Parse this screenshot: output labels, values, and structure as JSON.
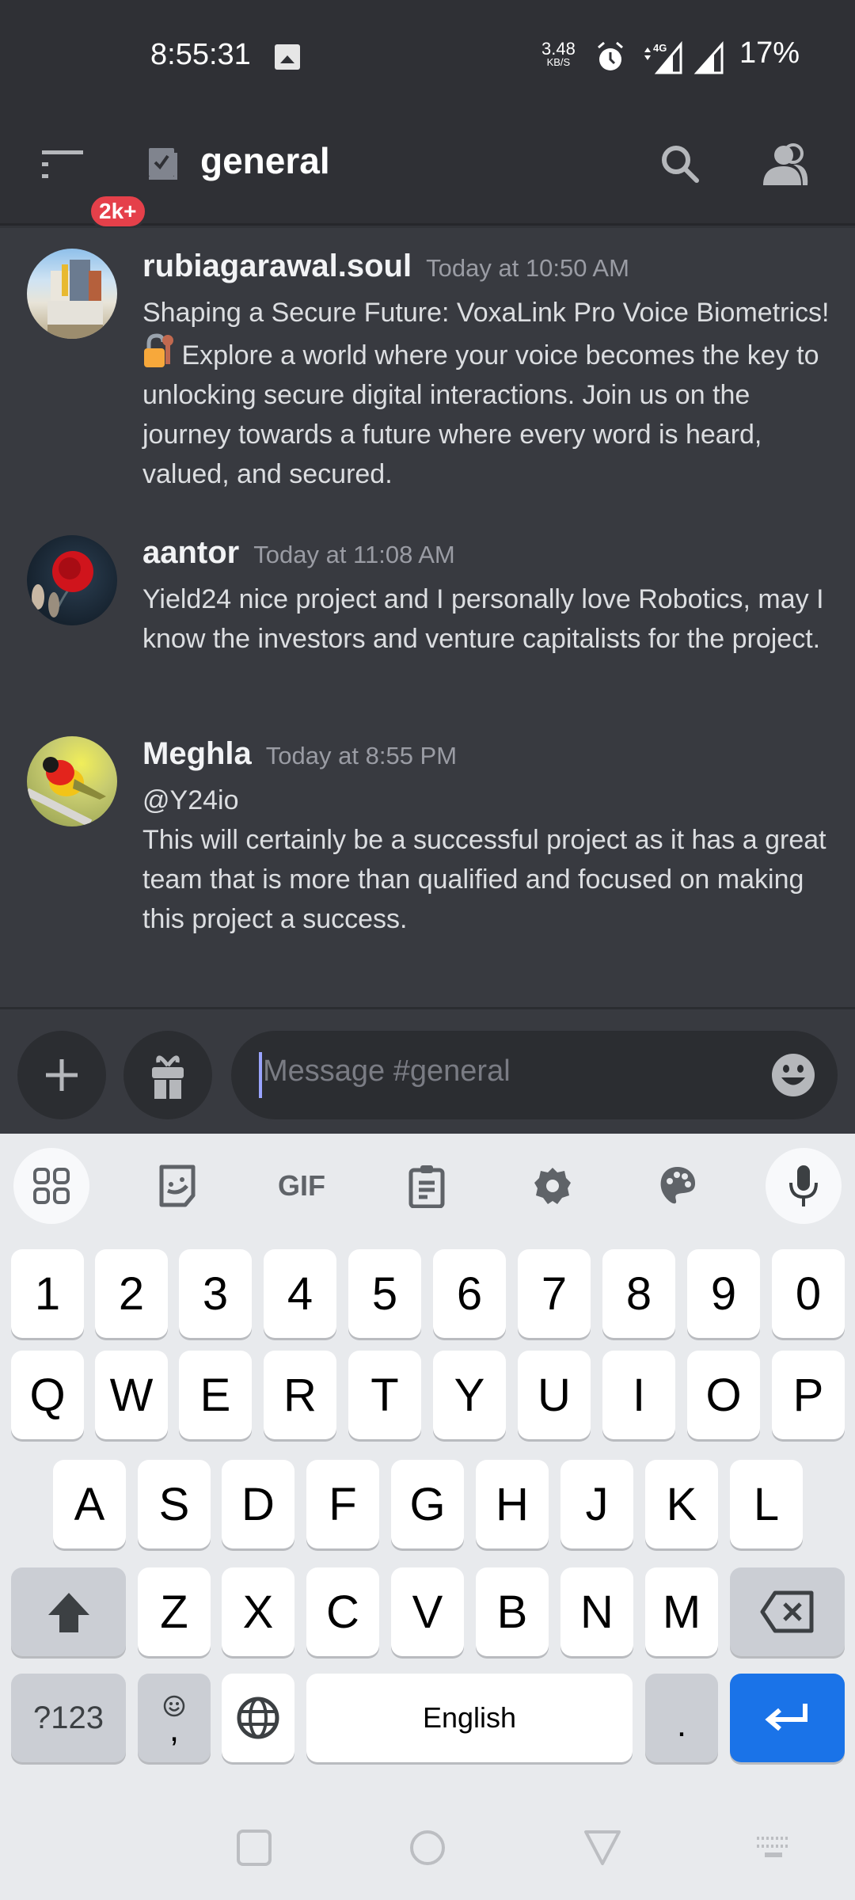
{
  "status_bar": {
    "time": "8:55:31",
    "net_speed_value": "3.48",
    "net_speed_unit": "KB/S",
    "network_type": "4G",
    "battery": "17%"
  },
  "header": {
    "unread_badge": "2k+",
    "channel_name": "general"
  },
  "messages": [
    {
      "author": "rubiagarawal.soul",
      "timestamp": "Today at 10:50 AM",
      "text_before_emoji": "Shaping a Secure Future: VoxaLink Pro Voice Biometrics!",
      "emoji": "lock-with-key",
      "text_after_emoji": "Explore a world where your voice becomes the key to unlocking secure digital interactions. Join us on the journey towards a future where every word is heard, valued, and secured."
    },
    {
      "author": "aantor",
      "timestamp": "Today at 11:08 AM",
      "text": "Yield24 nice project and I personally love Robotics, may I know the investors and venture capitalists for the project."
    },
    {
      "author": "Meghla",
      "timestamp": "Today at 8:55 PM",
      "mention": "@Y24io",
      "text": "This will certainly be a successful project as it has a great team that is more than qualified and focused on making this project a success."
    }
  ],
  "composer": {
    "placeholder": "Message #general",
    "value": ""
  },
  "keyboard": {
    "toolbar": [
      "apps-grid",
      "sticker",
      "GIF",
      "clipboard",
      "settings",
      "theme-palette",
      "microphone"
    ],
    "gif_label": "GIF",
    "row_numbers": [
      "1",
      "2",
      "3",
      "4",
      "5",
      "6",
      "7",
      "8",
      "9",
      "0"
    ],
    "row_1": [
      "Q",
      "W",
      "E",
      "R",
      "T",
      "Y",
      "U",
      "I",
      "O",
      "P"
    ],
    "row_2": [
      "A",
      "S",
      "D",
      "F",
      "G",
      "H",
      "J",
      "K",
      "L"
    ],
    "row_3": [
      "Z",
      "X",
      "C",
      "V",
      "B",
      "N",
      "M"
    ],
    "symbols_key": "?123",
    "comma_key": ",",
    "space_label": "English",
    "period_key": "."
  },
  "colors": {
    "badge": "#e5404a",
    "enter_key": "#1a73e8",
    "caret": "#9aa4ff"
  }
}
